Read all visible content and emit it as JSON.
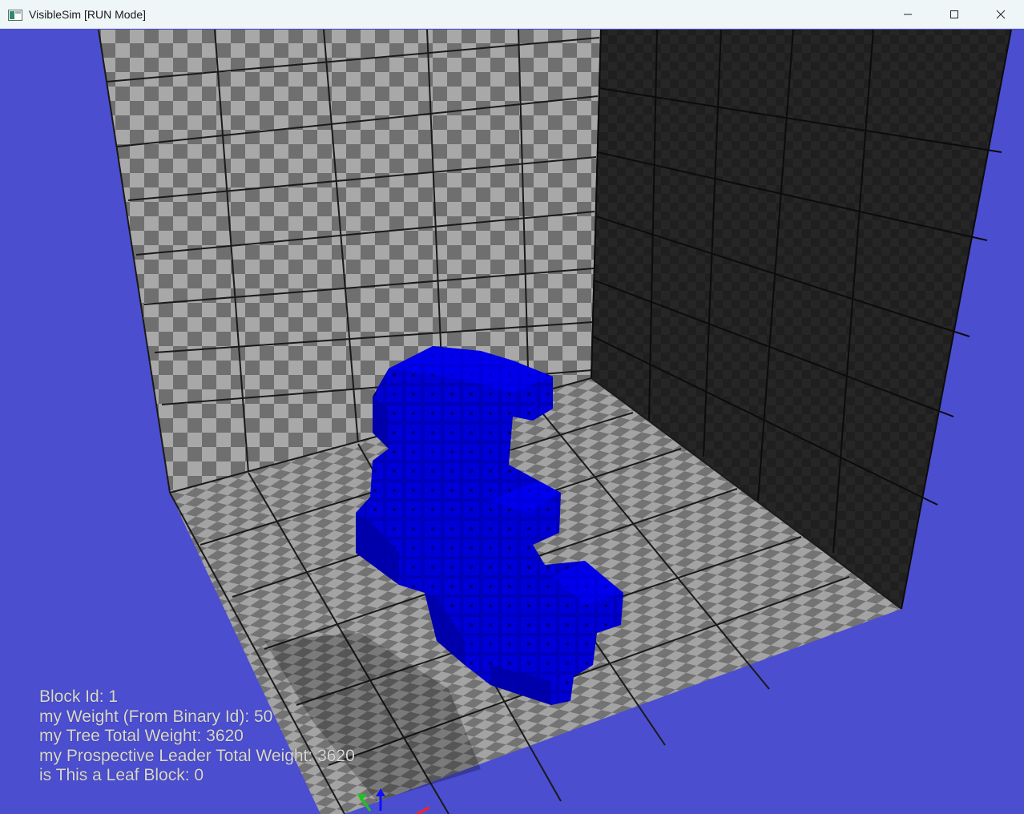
{
  "window": {
    "title": "VisibleSim [RUN Mode]",
    "controls": {
      "minimize_icon": "minimize-icon",
      "maximize_icon": "maximize-icon",
      "close_icon": "close-icon"
    }
  },
  "colors": {
    "background": "#4b4ecf",
    "blocks": "#0000d8",
    "light_tile": "#a6a6a6",
    "dark_tile": "#6f6f6f",
    "right_wall": "#1e1e1e"
  },
  "info_overlay": {
    "block_id": "Block Id: 1",
    "weight": "my Weight (From Binary Id): 50",
    "tree_total": "my Tree Total Weight: 3620",
    "leader_total": "my Prospective Leader Total Weight: 3620",
    "leaf_block": "is This a Leaf Block: 0"
  },
  "axes_gizmo": [
    "green-axis",
    "blue-axis",
    "red-axis"
  ]
}
